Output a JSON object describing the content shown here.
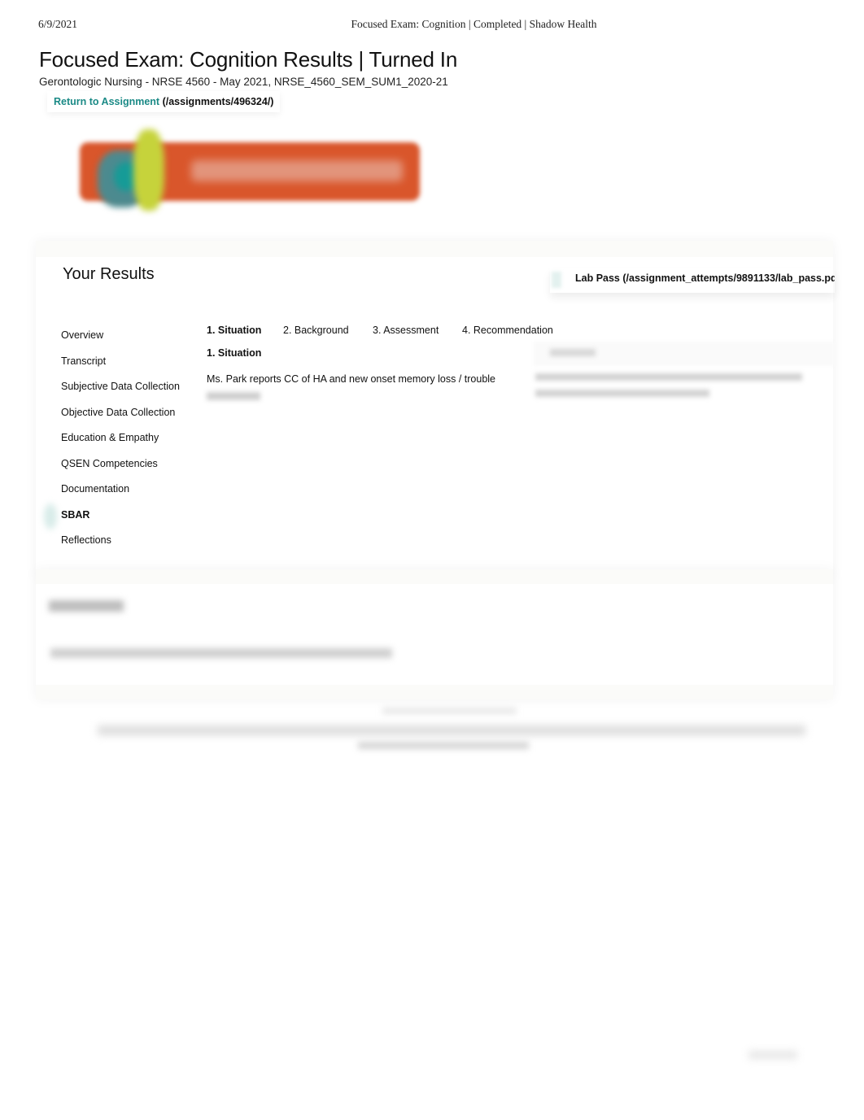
{
  "print_header": {
    "date": "6/9/2021",
    "title": "Focused Exam: Cognition | Completed | Shadow Health"
  },
  "page": {
    "title": "Focused Exam: Cognition Results | Turned In",
    "course": "Gerontologic Nursing - NRSE 4560 - May 2021, NRSE_4560_SEM_SUM1_2020-21",
    "return_link": {
      "label": "Return to Assignment",
      "url_text": "(/assignments/496324/)"
    },
    "logo_icon": "shadow-health-logo"
  },
  "colors": {
    "link_teal": "#1b8a86",
    "logo_orange": "#d9562b",
    "logo_green": "#c6d33b",
    "logo_teal": "#169b97"
  },
  "results": {
    "title": "Your Results",
    "lab_pass": "Lab Pass (/assignment_attempts/9891133/lab_pass.pd",
    "sidebar": {
      "items": [
        {
          "label": "Overview",
          "active": false
        },
        {
          "label": "Transcript",
          "active": false
        },
        {
          "label": "Subjective Data Collection",
          "active": false
        },
        {
          "label": "Objective Data Collection",
          "active": false
        },
        {
          "label": "Education & Empathy",
          "active": false
        },
        {
          "label": "QSEN Competencies",
          "active": false
        },
        {
          "label": "Documentation",
          "active": false
        },
        {
          "label": "SBAR",
          "active": true
        },
        {
          "label": "Reflections",
          "active": false
        }
      ]
    },
    "tabs": [
      {
        "label": "1. Situation",
        "active": true
      },
      {
        "label": "2. Background",
        "active": false
      },
      {
        "label": "3. Assessment",
        "active": false
      },
      {
        "label": "4. Recommendation",
        "active": false
      }
    ],
    "section_heading": "1. Situation",
    "situation_text": "Ms. Park reports CC of HA and new onset memory loss / trouble"
  }
}
